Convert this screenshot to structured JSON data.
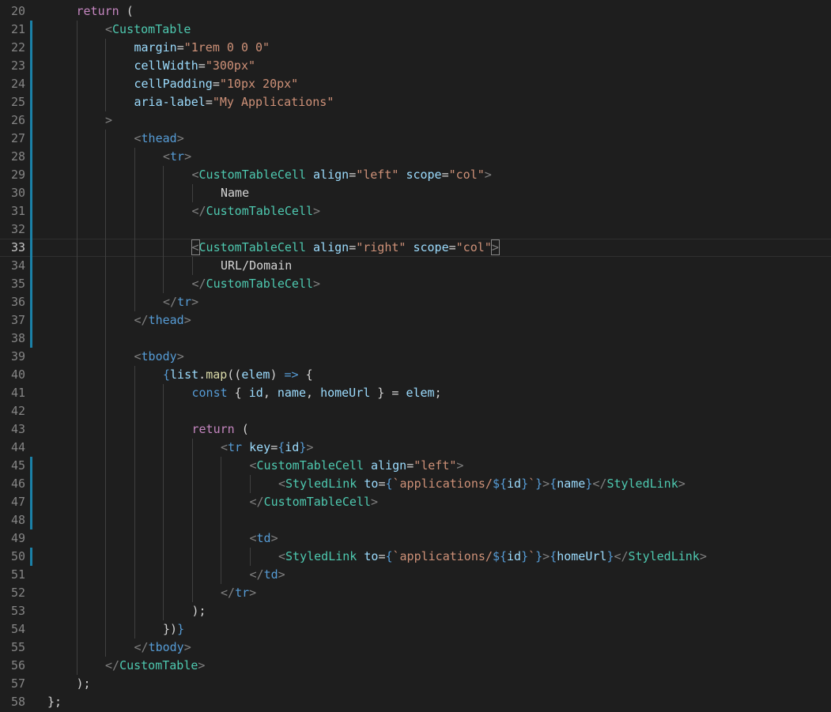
{
  "colors": {
    "background": "#1e1e1e",
    "line_number": "#858585",
    "line_number_active": "#c6c6c6",
    "plain": "#d4d4d4",
    "keyword": "#c586c0",
    "tag_bracket": "#808080",
    "html_tag": "#569cd6",
    "component": "#4ec9b0",
    "attribute": "#9cdcfe",
    "string": "#ce9178",
    "function": "#dcdcaa",
    "storage": "#569cd6",
    "variable": "#9cdcfe",
    "gutter_modified": "#1b81a8"
  },
  "active_line": 33,
  "lines": [
    {
      "n": "20",
      "indent": 1,
      "mod": false,
      "tokens": [
        [
          "return",
          "keyword"
        ],
        [
          " (",
          "plain"
        ]
      ]
    },
    {
      "n": "21",
      "indent": 2,
      "mod": true,
      "tokens": [
        [
          "<",
          "tag_bracket"
        ],
        [
          "CustomTable",
          "component"
        ]
      ]
    },
    {
      "n": "22",
      "indent": 3,
      "mod": true,
      "tokens": [
        [
          "margin",
          "attribute"
        ],
        [
          "=",
          "plain"
        ],
        [
          "\"1rem 0 0 0\"",
          "string"
        ]
      ]
    },
    {
      "n": "23",
      "indent": 3,
      "mod": true,
      "tokens": [
        [
          "cellWidth",
          "attribute"
        ],
        [
          "=",
          "plain"
        ],
        [
          "\"300px\"",
          "string"
        ]
      ]
    },
    {
      "n": "24",
      "indent": 3,
      "mod": true,
      "tokens": [
        [
          "cellPadding",
          "attribute"
        ],
        [
          "=",
          "plain"
        ],
        [
          "\"10px 20px\"",
          "string"
        ]
      ]
    },
    {
      "n": "25",
      "indent": 3,
      "mod": true,
      "tokens": [
        [
          "aria-label",
          "attribute"
        ],
        [
          "=",
          "plain"
        ],
        [
          "\"My Applications\"",
          "string"
        ]
      ]
    },
    {
      "n": "26",
      "indent": 2,
      "mod": true,
      "tokens": [
        [
          ">",
          "tag_bracket"
        ]
      ]
    },
    {
      "n": "27",
      "indent": 3,
      "mod": true,
      "tokens": [
        [
          "<",
          "tag_bracket"
        ],
        [
          "thead",
          "html_tag"
        ],
        [
          ">",
          "tag_bracket"
        ]
      ]
    },
    {
      "n": "28",
      "indent": 4,
      "mod": true,
      "tokens": [
        [
          "<",
          "tag_bracket"
        ],
        [
          "tr",
          "html_tag"
        ],
        [
          ">",
          "tag_bracket"
        ]
      ]
    },
    {
      "n": "29",
      "indent": 5,
      "mod": true,
      "tokens": [
        [
          "<",
          "tag_bracket"
        ],
        [
          "CustomTableCell",
          "component"
        ],
        [
          " ",
          "plain"
        ],
        [
          "align",
          "attribute"
        ],
        [
          "=",
          "plain"
        ],
        [
          "\"left\"",
          "string"
        ],
        [
          " ",
          "plain"
        ],
        [
          "scope",
          "attribute"
        ],
        [
          "=",
          "plain"
        ],
        [
          "\"col\"",
          "string"
        ],
        [
          ">",
          "tag_bracket"
        ]
      ]
    },
    {
      "n": "30",
      "indent": 6,
      "mod": true,
      "tokens": [
        [
          "Name",
          "plain"
        ]
      ]
    },
    {
      "n": "31",
      "indent": 5,
      "mod": true,
      "tokens": [
        [
          "</",
          "tag_bracket"
        ],
        [
          "CustomTableCell",
          "component"
        ],
        [
          ">",
          "tag_bracket"
        ]
      ]
    },
    {
      "n": "32",
      "indent": 0,
      "guides": 5,
      "mod": true,
      "tokens": []
    },
    {
      "n": "33",
      "indent": 5,
      "mod": true,
      "tokens": [
        [
          "<",
          "tag_bracket",
          "bh"
        ],
        [
          "CustomTableCell",
          "component"
        ],
        [
          " ",
          "plain"
        ],
        [
          "align",
          "attribute"
        ],
        [
          "=",
          "plain"
        ],
        [
          "\"right\"",
          "string"
        ],
        [
          " ",
          "plain"
        ],
        [
          "scope",
          "attribute"
        ],
        [
          "=",
          "plain"
        ],
        [
          "\"col\"",
          "string"
        ],
        [
          ">",
          "tag_bracket",
          "bh"
        ]
      ]
    },
    {
      "n": "34",
      "indent": 6,
      "mod": true,
      "tokens": [
        [
          "URL/Domain",
          "plain"
        ]
      ]
    },
    {
      "n": "35",
      "indent": 5,
      "mod": true,
      "tokens": [
        [
          "</",
          "tag_bracket"
        ],
        [
          "CustomTableCell",
          "component"
        ],
        [
          ">",
          "tag_bracket"
        ]
      ]
    },
    {
      "n": "36",
      "indent": 4,
      "mod": true,
      "tokens": [
        [
          "</",
          "tag_bracket"
        ],
        [
          "tr",
          "html_tag"
        ],
        [
          ">",
          "tag_bracket"
        ]
      ]
    },
    {
      "n": "37",
      "indent": 3,
      "mod": true,
      "tokens": [
        [
          "</",
          "tag_bracket"
        ],
        [
          "thead",
          "html_tag"
        ],
        [
          ">",
          "tag_bracket"
        ]
      ]
    },
    {
      "n": "38",
      "indent": 0,
      "guides": 3,
      "mod": true,
      "tokens": []
    },
    {
      "n": "39",
      "indent": 3,
      "mod": false,
      "tokens": [
        [
          "<",
          "tag_bracket"
        ],
        [
          "tbody",
          "html_tag"
        ],
        [
          ">",
          "tag_bracket"
        ]
      ]
    },
    {
      "n": "40",
      "indent": 4,
      "mod": false,
      "tokens": [
        [
          "{",
          "storage"
        ],
        [
          "list",
          "variable"
        ],
        [
          ".",
          "plain"
        ],
        [
          "map",
          "function"
        ],
        [
          "((",
          "plain"
        ],
        [
          "elem",
          "variable"
        ],
        [
          ") ",
          "plain"
        ],
        [
          "=>",
          "storage"
        ],
        [
          " {",
          "plain"
        ]
      ]
    },
    {
      "n": "41",
      "indent": 5,
      "mod": false,
      "tokens": [
        [
          "const",
          "storage"
        ],
        [
          " { ",
          "plain"
        ],
        [
          "id",
          "variable"
        ],
        [
          ", ",
          "plain"
        ],
        [
          "name",
          "variable"
        ],
        [
          ", ",
          "plain"
        ],
        [
          "homeUrl",
          "variable"
        ],
        [
          " } = ",
          "plain"
        ],
        [
          "elem",
          "variable"
        ],
        [
          ";",
          "plain"
        ]
      ]
    },
    {
      "n": "42",
      "indent": 0,
      "guides": 5,
      "mod": false,
      "tokens": []
    },
    {
      "n": "43",
      "indent": 5,
      "mod": false,
      "tokens": [
        [
          "return",
          "keyword"
        ],
        [
          " (",
          "plain"
        ]
      ]
    },
    {
      "n": "44",
      "indent": 6,
      "mod": false,
      "tokens": [
        [
          "<",
          "tag_bracket"
        ],
        [
          "tr",
          "html_tag"
        ],
        [
          " ",
          "plain"
        ],
        [
          "key",
          "attribute"
        ],
        [
          "=",
          "plain"
        ],
        [
          "{",
          "storage"
        ],
        [
          "id",
          "variable"
        ],
        [
          "}",
          "storage"
        ],
        [
          ">",
          "tag_bracket"
        ]
      ]
    },
    {
      "n": "45",
      "indent": 7,
      "mod": true,
      "tokens": [
        [
          "<",
          "tag_bracket"
        ],
        [
          "CustomTableCell",
          "component"
        ],
        [
          " ",
          "plain"
        ],
        [
          "align",
          "attribute"
        ],
        [
          "=",
          "plain"
        ],
        [
          "\"left\"",
          "string"
        ],
        [
          ">",
          "tag_bracket"
        ]
      ]
    },
    {
      "n": "46",
      "indent": 8,
      "mod": true,
      "tokens": [
        [
          "<",
          "tag_bracket"
        ],
        [
          "StyledLink",
          "component"
        ],
        [
          " ",
          "plain"
        ],
        [
          "to",
          "attribute"
        ],
        [
          "=",
          "plain"
        ],
        [
          "{",
          "storage"
        ],
        [
          "`applications/",
          "string"
        ],
        [
          "${",
          "storage"
        ],
        [
          "id",
          "variable"
        ],
        [
          "}",
          "storage"
        ],
        [
          "`",
          "string"
        ],
        [
          "}",
          "storage"
        ],
        [
          ">",
          "tag_bracket"
        ],
        [
          "{",
          "storage"
        ],
        [
          "name",
          "variable"
        ],
        [
          "}",
          "storage"
        ],
        [
          "</",
          "tag_bracket"
        ],
        [
          "StyledLink",
          "component"
        ],
        [
          ">",
          "tag_bracket"
        ]
      ]
    },
    {
      "n": "47",
      "indent": 7,
      "mod": true,
      "tokens": [
        [
          "</",
          "tag_bracket"
        ],
        [
          "CustomTableCell",
          "component"
        ],
        [
          ">",
          "tag_bracket"
        ]
      ]
    },
    {
      "n": "48",
      "indent": 0,
      "guides": 7,
      "mod": true,
      "tokens": []
    },
    {
      "n": "49",
      "indent": 7,
      "mod": false,
      "tokens": [
        [
          "<",
          "tag_bracket"
        ],
        [
          "td",
          "html_tag"
        ],
        [
          ">",
          "tag_bracket"
        ]
      ]
    },
    {
      "n": "50",
      "indent": 8,
      "mod": true,
      "tokens": [
        [
          "<",
          "tag_bracket"
        ],
        [
          "StyledLink",
          "component"
        ],
        [
          " ",
          "plain"
        ],
        [
          "to",
          "attribute"
        ],
        [
          "=",
          "plain"
        ],
        [
          "{",
          "storage"
        ],
        [
          "`applications/",
          "string"
        ],
        [
          "${",
          "storage"
        ],
        [
          "id",
          "variable"
        ],
        [
          "}",
          "storage"
        ],
        [
          "`",
          "string"
        ],
        [
          "}",
          "storage"
        ],
        [
          ">",
          "tag_bracket"
        ],
        [
          "{",
          "storage"
        ],
        [
          "homeUrl",
          "variable"
        ],
        [
          "}",
          "storage"
        ],
        [
          "</",
          "tag_bracket"
        ],
        [
          "StyledLink",
          "component"
        ],
        [
          ">",
          "tag_bracket"
        ]
      ]
    },
    {
      "n": "51",
      "indent": 7,
      "mod": false,
      "tokens": [
        [
          "</",
          "tag_bracket"
        ],
        [
          "td",
          "html_tag"
        ],
        [
          ">",
          "tag_bracket"
        ]
      ]
    },
    {
      "n": "52",
      "indent": 6,
      "mod": false,
      "tokens": [
        [
          "</",
          "tag_bracket"
        ],
        [
          "tr",
          "html_tag"
        ],
        [
          ">",
          "tag_bracket"
        ]
      ]
    },
    {
      "n": "53",
      "indent": 5,
      "mod": false,
      "tokens": [
        [
          ");",
          "plain"
        ]
      ]
    },
    {
      "n": "54",
      "indent": 4,
      "mod": false,
      "tokens": [
        [
          "})",
          "plain"
        ],
        [
          "}",
          "storage"
        ]
      ]
    },
    {
      "n": "55",
      "indent": 3,
      "mod": false,
      "tokens": [
        [
          "</",
          "tag_bracket"
        ],
        [
          "tbody",
          "html_tag"
        ],
        [
          ">",
          "tag_bracket"
        ]
      ]
    },
    {
      "n": "56",
      "indent": 2,
      "mod": false,
      "tokens": [
        [
          "</",
          "tag_bracket"
        ],
        [
          "CustomTable",
          "component"
        ],
        [
          ">",
          "tag_bracket"
        ]
      ]
    },
    {
      "n": "57",
      "indent": 1,
      "mod": false,
      "tokens": [
        [
          ");",
          "plain"
        ]
      ]
    },
    {
      "n": "58",
      "indent": 0,
      "mod": false,
      "tokens": [
        [
          "};",
          "plain"
        ]
      ]
    }
  ]
}
